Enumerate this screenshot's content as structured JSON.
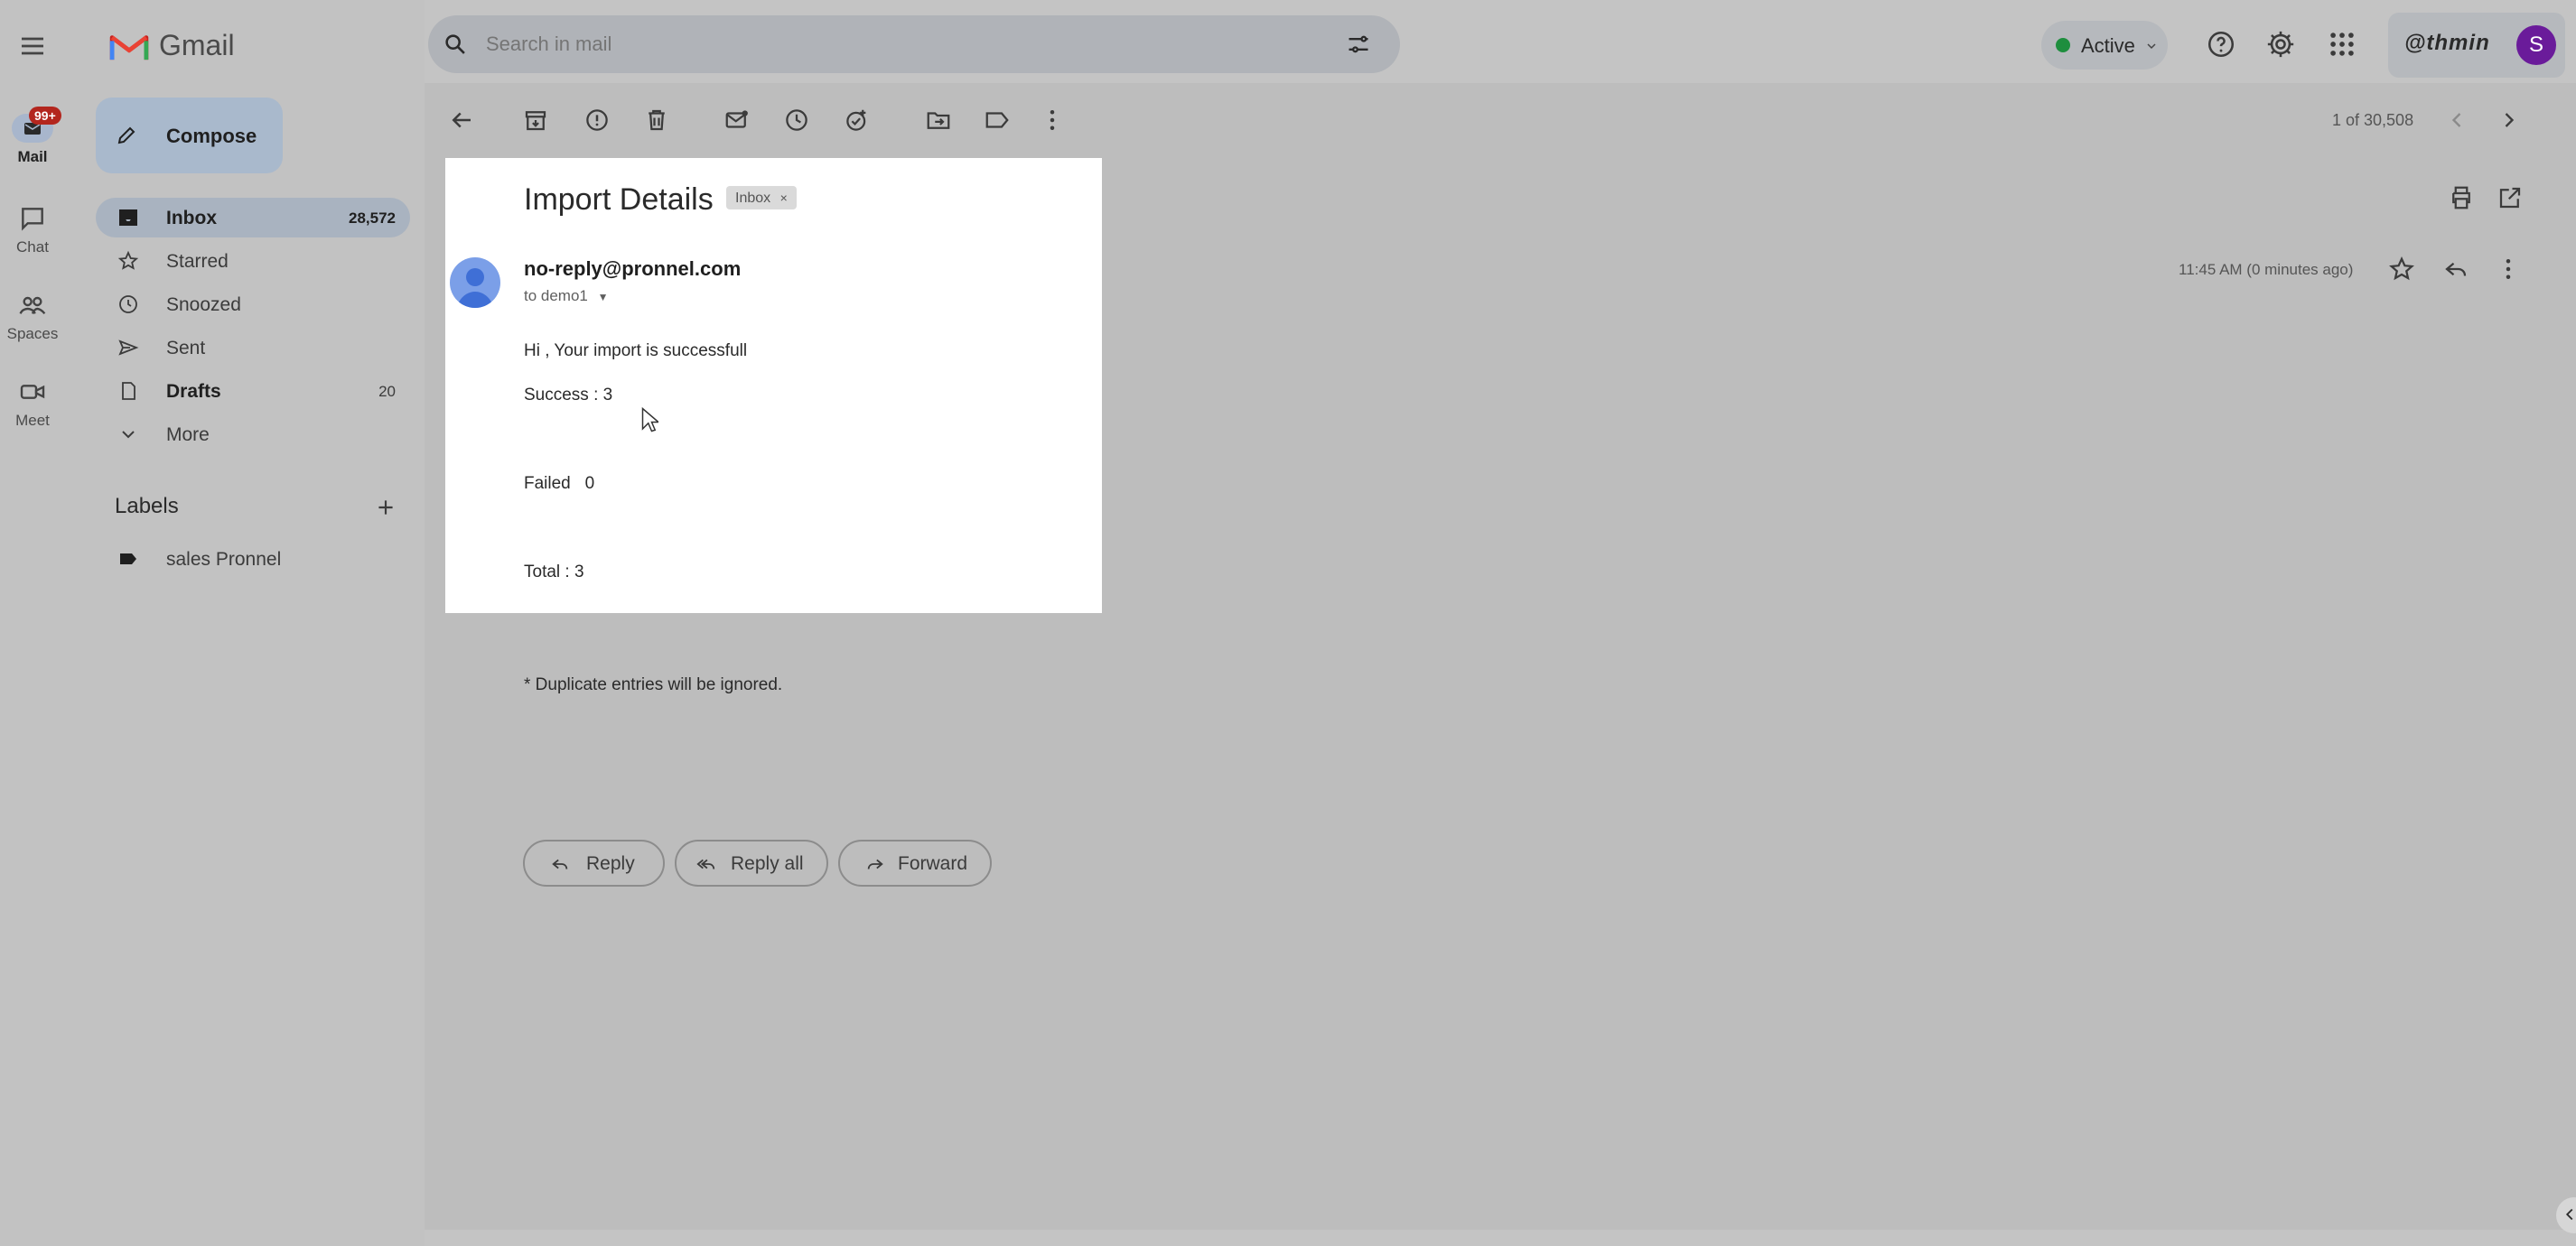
{
  "app": {
    "name": "Gmail"
  },
  "search": {
    "placeholder": "Search in mail"
  },
  "status": {
    "label": "Active"
  },
  "account": {
    "org_logo": "@thmin",
    "avatar_letter": "S"
  },
  "rail": {
    "badge": "99+",
    "items": [
      {
        "label": "Mail",
        "icon": "mail-icon"
      },
      {
        "label": "Chat",
        "icon": "chat-icon"
      },
      {
        "label": "Spaces",
        "icon": "spaces-icon"
      },
      {
        "label": "Meet",
        "icon": "meet-icon"
      }
    ]
  },
  "compose": {
    "label": "Compose"
  },
  "nav": [
    {
      "label": "Inbox",
      "count": "28,572",
      "icon": "inbox-icon",
      "bold": true,
      "selected": true
    },
    {
      "label": "Starred",
      "count": "",
      "icon": "star-icon"
    },
    {
      "label": "Snoozed",
      "count": "",
      "icon": "clock-icon"
    },
    {
      "label": "Sent",
      "count": "",
      "icon": "send-icon"
    },
    {
      "label": "Drafts",
      "count": "20",
      "icon": "draft-icon",
      "bold": true
    },
    {
      "label": "More",
      "count": "",
      "icon": "chevron-down-icon"
    }
  ],
  "labels": {
    "title": "Labels",
    "items": [
      {
        "label": "sales Pronnel",
        "icon": "label-icon"
      }
    ]
  },
  "pagination": {
    "text": "1 of 30,508"
  },
  "email": {
    "subject": "Import Details",
    "chip": "Inbox",
    "sender": "no-reply@pronnel.com",
    "recipient": "to demo1",
    "time": "11:45 AM (0 minutes ago)",
    "body": {
      "greeting": "Hi , Your import is successfull",
      "success": "Success : 3",
      "failed": "Failed   0",
      "total": "Total : 3",
      "note": "* Duplicate entries will be ignored."
    }
  },
  "actions": {
    "reply": "Reply",
    "reply_all": "Reply all",
    "forward": "Forward"
  },
  "colors": {
    "active_dot": "#1e8e3e",
    "badge": "#b3261e",
    "avatar": "#6a1b9a",
    "sender_avatar": "#7b9fe8"
  }
}
